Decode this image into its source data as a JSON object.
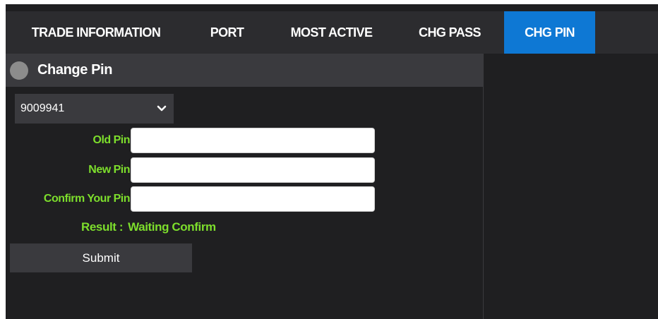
{
  "tabs": [
    {
      "label": "TRADE INFORMATION",
      "active": false
    },
    {
      "label": "PORT",
      "active": false
    },
    {
      "label": "MOST ACTIVE",
      "active": false
    },
    {
      "label": "CHG PASS",
      "active": false
    },
    {
      "label": "CHG PIN",
      "active": true
    }
  ],
  "panel": {
    "title": "Change Pin",
    "icon": "circle-icon"
  },
  "account_select": {
    "selected": "9009941",
    "icon": "chevron-down-icon"
  },
  "form": {
    "old_pin_label": "Old Pin",
    "new_pin_label": "New Pin",
    "confirm_pin_label": "Confirm Your Pin",
    "old_pin_value": "",
    "new_pin_value": "",
    "confirm_pin_value": ""
  },
  "result": {
    "label": "Result :",
    "value": "Waiting Confirm"
  },
  "submit_label": "Submit",
  "colors": {
    "background": "#1f1f21",
    "tab_bar": "#2c2c2f",
    "active_tab": "#0e78d4",
    "panel_header": "#3a3a3e",
    "label_green": "#7dde2c"
  }
}
